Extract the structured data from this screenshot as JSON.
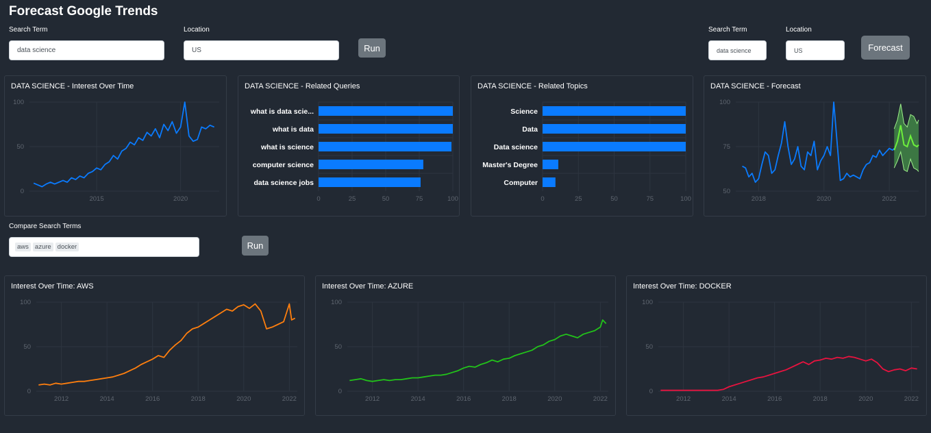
{
  "app": {
    "title": "Forecast Google Trends"
  },
  "top_controls": {
    "search_label": "Search Term",
    "search_value": "data science",
    "location_label": "Location",
    "location_value": "US",
    "run_label": "Run"
  },
  "forecast_controls": {
    "search_label": "Search Term",
    "search_value": "data science",
    "location_label": "Location",
    "location_value": "US",
    "forecast_label": "Forecast"
  },
  "compare": {
    "label": "Compare Search Terms",
    "tags": [
      "aws",
      "azure",
      "docker"
    ],
    "run_label": "Run"
  },
  "colors": {
    "background": "#222933",
    "card_border": "#343c47",
    "blue": "#0a7bff",
    "orange": "#ff7f0e",
    "green": "#22c31a",
    "red": "#e8133f",
    "forecast_line": "#6df03c",
    "forecast_band": "#3f7f45",
    "button": "#6c757d"
  },
  "chart_titles": {
    "interest": "DATA SCIENCE - Interest Over Time",
    "queries": "DATA SCIENCE - Related Queries",
    "topics": "DATA SCIENCE - Related Topics",
    "forecast": "DATA SCIENCE - Forecast",
    "aws": "Interest Over Time: AWS",
    "azure": "Interest Over Time: AZURE",
    "docker": "Interest Over Time: DOCKER"
  },
  "chart_data": [
    {
      "id": "interest",
      "type": "line",
      "title": "DATA SCIENCE - Interest Over Time",
      "color": "#0a7bff",
      "xlim": [
        2011.0,
        2022.3
      ],
      "ylim": [
        0,
        100
      ],
      "xticks": [
        2015,
        2020
      ],
      "yticks": [
        0,
        50,
        100
      ],
      "points": [
        [
          2011.25,
          9
        ],
        [
          2011.5,
          7
        ],
        [
          2011.75,
          5
        ],
        [
          2012.0,
          8
        ],
        [
          2012.25,
          10
        ],
        [
          2012.5,
          8
        ],
        [
          2012.75,
          10
        ],
        [
          2013.0,
          12
        ],
        [
          2013.25,
          10
        ],
        [
          2013.5,
          15
        ],
        [
          2013.75,
          13
        ],
        [
          2014.0,
          17
        ],
        [
          2014.25,
          15
        ],
        [
          2014.5,
          20
        ],
        [
          2014.75,
          22
        ],
        [
          2015.0,
          26
        ],
        [
          2015.25,
          24
        ],
        [
          2015.5,
          30
        ],
        [
          2015.75,
          33
        ],
        [
          2016.0,
          40
        ],
        [
          2016.25,
          36
        ],
        [
          2016.5,
          45
        ],
        [
          2016.75,
          48
        ],
        [
          2017.0,
          55
        ],
        [
          2017.25,
          52
        ],
        [
          2017.5,
          60
        ],
        [
          2017.75,
          57
        ],
        [
          2018.0,
          66
        ],
        [
          2018.25,
          62
        ],
        [
          2018.5,
          70
        ],
        [
          2018.75,
          60
        ],
        [
          2019.0,
          75
        ],
        [
          2019.25,
          68
        ],
        [
          2019.5,
          78
        ],
        [
          2019.75,
          65
        ],
        [
          2020.0,
          72
        ],
        [
          2020.25,
          100
        ],
        [
          2020.5,
          62
        ],
        [
          2020.75,
          56
        ],
        [
          2021.0,
          58
        ],
        [
          2021.25,
          72
        ],
        [
          2021.5,
          70
        ],
        [
          2021.75,
          74
        ],
        [
          2022.0,
          72
        ]
      ]
    },
    {
      "id": "queries",
      "type": "bar",
      "orientation": "horizontal",
      "title": "DATA SCIENCE - Related Queries",
      "color": "#0a7bff",
      "categories": [
        "what is data scie...",
        "what is data",
        "what is science",
        "computer science",
        "data science jobs"
      ],
      "values": [
        100,
        100,
        99,
        78,
        76
      ],
      "xlim": [
        0,
        100
      ],
      "xticks": [
        0,
        25,
        50,
        75,
        100
      ]
    },
    {
      "id": "topics",
      "type": "bar",
      "orientation": "horizontal",
      "title": "DATA SCIENCE - Related Topics",
      "color": "#0a7bff",
      "categories": [
        "Science",
        "Data",
        "Data science",
        "Master's Degree",
        "Computer"
      ],
      "values": [
        100,
        100,
        100,
        11,
        9
      ],
      "xlim": [
        0,
        100
      ],
      "xticks": [
        0,
        25,
        50,
        75,
        100
      ]
    },
    {
      "id": "forecast",
      "type": "line",
      "title": "DATA SCIENCE - Forecast",
      "color": "#0a7bff",
      "xlim": [
        2017.3,
        2022.9
      ],
      "ylim": [
        50,
        100
      ],
      "xticks": [
        2018,
        2020,
        2022
      ],
      "yticks": [
        50,
        75,
        100
      ],
      "points": [
        [
          2017.5,
          64
        ],
        [
          2017.6,
          63
        ],
        [
          2017.7,
          58
        ],
        [
          2017.8,
          60
        ],
        [
          2017.9,
          55
        ],
        [
          2018.0,
          57
        ],
        [
          2018.1,
          65
        ],
        [
          2018.2,
          72
        ],
        [
          2018.3,
          70
        ],
        [
          2018.4,
          60
        ],
        [
          2018.5,
          62
        ],
        [
          2018.6,
          70
        ],
        [
          2018.7,
          77
        ],
        [
          2018.8,
          89
        ],
        [
          2018.9,
          75
        ],
        [
          2019.0,
          65
        ],
        [
          2019.1,
          68
        ],
        [
          2019.2,
          75
        ],
        [
          2019.3,
          64
        ],
        [
          2019.4,
          62
        ],
        [
          2019.5,
          72
        ],
        [
          2019.6,
          70
        ],
        [
          2019.7,
          78
        ],
        [
          2019.8,
          62
        ],
        [
          2019.9,
          67
        ],
        [
          2020.0,
          70
        ],
        [
          2020.1,
          75
        ],
        [
          2020.2,
          70
        ],
        [
          2020.3,
          100
        ],
        [
          2020.4,
          78
        ],
        [
          2020.5,
          56
        ],
        [
          2020.6,
          57
        ],
        [
          2020.7,
          60
        ],
        [
          2020.8,
          58
        ],
        [
          2020.9,
          59
        ],
        [
          2021.0,
          58
        ],
        [
          2021.1,
          57
        ],
        [
          2021.2,
          62
        ],
        [
          2021.3,
          65
        ],
        [
          2021.4,
          66
        ],
        [
          2021.5,
          70
        ],
        [
          2021.6,
          69
        ],
        [
          2021.7,
          73
        ],
        [
          2021.8,
          70
        ],
        [
          2021.9,
          72
        ],
        [
          2022.0,
          74
        ],
        [
          2022.1,
          73
        ],
        [
          2022.15,
          74
        ]
      ],
      "forecast": [
        [
          2022.15,
          73
        ],
        [
          2022.25,
          78
        ],
        [
          2022.35,
          87
        ],
        [
          2022.45,
          76
        ],
        [
          2022.55,
          75
        ],
        [
          2022.65,
          81
        ],
        [
          2022.75,
          76
        ],
        [
          2022.85,
          75
        ],
        [
          2022.9,
          76
        ]
      ],
      "forecast_upper": [
        [
          2022.15,
          85
        ],
        [
          2022.25,
          90
        ],
        [
          2022.35,
          99
        ],
        [
          2022.45,
          88
        ],
        [
          2022.55,
          86
        ],
        [
          2022.65,
          93
        ],
        [
          2022.75,
          92
        ],
        [
          2022.85,
          88
        ],
        [
          2022.9,
          90
        ]
      ],
      "forecast_lower": [
        [
          2022.15,
          63
        ],
        [
          2022.25,
          67
        ],
        [
          2022.35,
          72
        ],
        [
          2022.45,
          62
        ],
        [
          2022.55,
          61
        ],
        [
          2022.65,
          68
        ],
        [
          2022.75,
          63
        ],
        [
          2022.85,
          62
        ],
        [
          2022.9,
          61
        ]
      ]
    },
    {
      "id": "aws",
      "type": "line",
      "title": "Interest Over Time: AWS",
      "color": "#ff7f0e",
      "xlim": [
        2010.9,
        2022.35
      ],
      "ylim": [
        0,
        100
      ],
      "xticks": [
        2012,
        2014,
        2016,
        2018,
        2020,
        2022
      ],
      "yticks": [
        0,
        50,
        100
      ],
      "points": [
        [
          2011.0,
          7
        ],
        [
          2011.25,
          8
        ],
        [
          2011.5,
          7
        ],
        [
          2011.75,
          9
        ],
        [
          2012.0,
          8
        ],
        [
          2012.25,
          9
        ],
        [
          2012.5,
          10
        ],
        [
          2012.75,
          11
        ],
        [
          2013.0,
          11
        ],
        [
          2013.25,
          12
        ],
        [
          2013.5,
          13
        ],
        [
          2013.75,
          14
        ],
        [
          2014.0,
          15
        ],
        [
          2014.25,
          16
        ],
        [
          2014.5,
          18
        ],
        [
          2014.75,
          20
        ],
        [
          2015.0,
          23
        ],
        [
          2015.25,
          26
        ],
        [
          2015.5,
          30
        ],
        [
          2015.75,
          33
        ],
        [
          2016.0,
          36
        ],
        [
          2016.25,
          40
        ],
        [
          2016.5,
          38
        ],
        [
          2016.75,
          46
        ],
        [
          2017.0,
          52
        ],
        [
          2017.25,
          57
        ],
        [
          2017.5,
          65
        ],
        [
          2017.75,
          70
        ],
        [
          2018.0,
          72
        ],
        [
          2018.25,
          76
        ],
        [
          2018.5,
          80
        ],
        [
          2018.75,
          84
        ],
        [
          2019.0,
          88
        ],
        [
          2019.25,
          92
        ],
        [
          2019.5,
          90
        ],
        [
          2019.75,
          95
        ],
        [
          2020.0,
          97
        ],
        [
          2020.25,
          93
        ],
        [
          2020.5,
          98
        ],
        [
          2020.75,
          90
        ],
        [
          2021.0,
          70
        ],
        [
          2021.25,
          72
        ],
        [
          2021.5,
          75
        ],
        [
          2021.75,
          78
        ],
        [
          2022.0,
          98
        ],
        [
          2022.1,
          80
        ],
        [
          2022.25,
          82
        ]
      ]
    },
    {
      "id": "azure",
      "type": "line",
      "title": "Interest Over Time: AZURE",
      "color": "#22c31a",
      "xlim": [
        2010.9,
        2022.35
      ],
      "ylim": [
        0,
        100
      ],
      "xticks": [
        2012,
        2014,
        2016,
        2018,
        2020,
        2022
      ],
      "yticks": [
        0,
        50,
        100
      ],
      "points": [
        [
          2011.0,
          12
        ],
        [
          2011.25,
          13
        ],
        [
          2011.5,
          14
        ],
        [
          2011.75,
          12
        ],
        [
          2012.0,
          11
        ],
        [
          2012.25,
          12
        ],
        [
          2012.5,
          13
        ],
        [
          2012.75,
          12
        ],
        [
          2013.0,
          13
        ],
        [
          2013.25,
          13
        ],
        [
          2013.5,
          14
        ],
        [
          2013.75,
          15
        ],
        [
          2014.0,
          15
        ],
        [
          2014.25,
          16
        ],
        [
          2014.5,
          17
        ],
        [
          2014.75,
          18
        ],
        [
          2015.0,
          18
        ],
        [
          2015.25,
          19
        ],
        [
          2015.5,
          21
        ],
        [
          2015.75,
          23
        ],
        [
          2016.0,
          26
        ],
        [
          2016.25,
          28
        ],
        [
          2016.5,
          27
        ],
        [
          2016.75,
          30
        ],
        [
          2017.0,
          32
        ],
        [
          2017.25,
          35
        ],
        [
          2017.5,
          33
        ],
        [
          2017.75,
          36
        ],
        [
          2018.0,
          37
        ],
        [
          2018.25,
          40
        ],
        [
          2018.5,
          42
        ],
        [
          2018.75,
          44
        ],
        [
          2019.0,
          46
        ],
        [
          2019.25,
          50
        ],
        [
          2019.5,
          52
        ],
        [
          2019.75,
          56
        ],
        [
          2020.0,
          58
        ],
        [
          2020.25,
          62
        ],
        [
          2020.5,
          64
        ],
        [
          2020.75,
          62
        ],
        [
          2021.0,
          60
        ],
        [
          2021.25,
          64
        ],
        [
          2021.5,
          66
        ],
        [
          2021.75,
          68
        ],
        [
          2022.0,
          72
        ],
        [
          2022.1,
          80
        ],
        [
          2022.25,
          76
        ]
      ]
    },
    {
      "id": "docker",
      "type": "line",
      "title": "Interest Over Time: DOCKER",
      "color": "#e8133f",
      "xlim": [
        2010.9,
        2022.35
      ],
      "ylim": [
        0,
        100
      ],
      "xticks": [
        2012,
        2014,
        2016,
        2018,
        2020,
        2022
      ],
      "yticks": [
        0,
        50,
        100
      ],
      "points": [
        [
          2011.0,
          1
        ],
        [
          2011.5,
          1
        ],
        [
          2012.0,
          1
        ],
        [
          2012.5,
          1
        ],
        [
          2013.0,
          1
        ],
        [
          2013.5,
          1
        ],
        [
          2013.75,
          2
        ],
        [
          2014.0,
          5
        ],
        [
          2014.25,
          7
        ],
        [
          2014.5,
          9
        ],
        [
          2014.75,
          11
        ],
        [
          2015.0,
          13
        ],
        [
          2015.25,
          15
        ],
        [
          2015.5,
          16
        ],
        [
          2015.75,
          18
        ],
        [
          2016.0,
          20
        ],
        [
          2016.25,
          22
        ],
        [
          2016.5,
          24
        ],
        [
          2016.75,
          27
        ],
        [
          2017.0,
          30
        ],
        [
          2017.25,
          33
        ],
        [
          2017.5,
          30
        ],
        [
          2017.75,
          34
        ],
        [
          2018.0,
          35
        ],
        [
          2018.25,
          37
        ],
        [
          2018.5,
          36
        ],
        [
          2018.75,
          38
        ],
        [
          2019.0,
          37
        ],
        [
          2019.25,
          39
        ],
        [
          2019.5,
          38
        ],
        [
          2019.75,
          36
        ],
        [
          2020.0,
          34
        ],
        [
          2020.25,
          36
        ],
        [
          2020.5,
          32
        ],
        [
          2020.75,
          25
        ],
        [
          2021.0,
          22
        ],
        [
          2021.25,
          24
        ],
        [
          2021.5,
          25
        ],
        [
          2021.75,
          23
        ],
        [
          2022.0,
          26
        ],
        [
          2022.25,
          25
        ]
      ]
    }
  ]
}
